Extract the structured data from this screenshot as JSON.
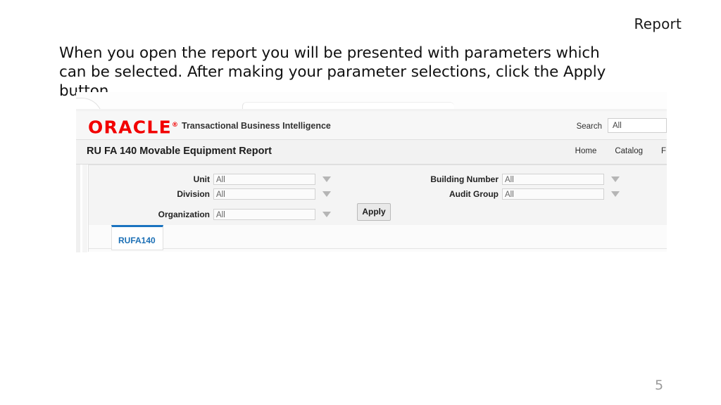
{
  "slide": {
    "header": "Report",
    "body": "When you open the report you will be presented with parameters which can be selected.  After making your parameter selections, click the Apply button.",
    "page_number": "5"
  },
  "screenshot": {
    "brand": {
      "logo_text": "ORACLE",
      "registered_mark": "®",
      "logo_color": "#f20000",
      "subtitle": "Transactional Business Intelligence",
      "search_label": "Search",
      "search_value": "All"
    },
    "report": {
      "title": "RU FA 140 Movable Equipment Report",
      "nav": [
        {
          "label": "Home"
        },
        {
          "label": "Catalog"
        },
        {
          "label": "F"
        }
      ]
    },
    "parameters": {
      "left_column": [
        {
          "label": "Unit",
          "value": "All"
        },
        {
          "label": "Division",
          "value": "All"
        },
        {
          "label": "Organization",
          "value": "All"
        }
      ],
      "right_column": [
        {
          "label": "Building Number",
          "value": "All"
        },
        {
          "label": "Audit Group",
          "value": "All"
        }
      ],
      "apply_label": "Apply"
    },
    "results": {
      "tabs": [
        {
          "label": "RUFA140",
          "active": true,
          "accent": "#1a73c0"
        }
      ]
    }
  }
}
